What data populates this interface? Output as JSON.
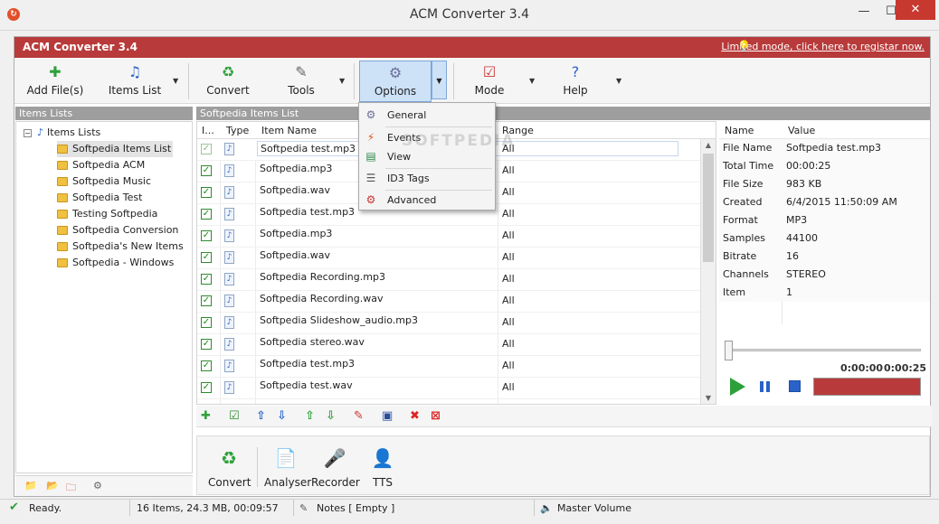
{
  "window": {
    "title": "ACM Converter 3.4",
    "min": "—",
    "max": "☐",
    "close": "✕"
  },
  "banner": {
    "app_name": "ACM Converter 3.4",
    "link": "Limited mode, click here to registar now."
  },
  "toolbar": {
    "add_files": "Add File(s)",
    "items_list": "Items List",
    "convert": "Convert",
    "tools": "Tools",
    "options": "Options",
    "mode": "Mode",
    "help": "Help"
  },
  "left_panel": {
    "header": "Items Lists",
    "root": "Items Lists",
    "items": [
      "Softpedia Items List",
      "Softpedia ACM",
      "Softpedia Music",
      "Softpedia Test",
      "Testing Softpedia",
      "Softpedia Conversion",
      "Softpedia's New Items",
      "Softpedia - Windows"
    ]
  },
  "center_panel": {
    "header": "Softpedia Items List",
    "columns": [
      "I...",
      "Type",
      "Item Name",
      "Range"
    ],
    "rows": [
      {
        "name": "Softpedia test.mp3",
        "range": "All",
        "checked_dim": true
      },
      {
        "name": "Softpedia.mp3",
        "range": "All"
      },
      {
        "name": "Softpedia.wav",
        "range": "All"
      },
      {
        "name": "Softpedia test.mp3",
        "range": "All"
      },
      {
        "name": "Softpedia.mp3",
        "range": "All"
      },
      {
        "name": "Softpedia.wav",
        "range": "All"
      },
      {
        "name": "Softpedia Recording.mp3",
        "range": "All"
      },
      {
        "name": "Softpedia Recording.wav",
        "range": "All"
      },
      {
        "name": "Softpedia Slideshow_audio.mp3",
        "range": "All"
      },
      {
        "name": "Softpedia stereo.wav",
        "range": "All"
      },
      {
        "name": "Softpedia test.mp3",
        "range": "All"
      },
      {
        "name": "Softpedia test.wav",
        "range": "All"
      }
    ]
  },
  "options_menu": {
    "items": [
      "General",
      "Events",
      "View",
      "ID3 Tags",
      "Advanced"
    ]
  },
  "watermark": "SOFTPEDIA",
  "properties": {
    "columns": [
      "Name",
      "Value"
    ],
    "rows": [
      {
        "name": "File Name",
        "value": "Softpedia test.mp3"
      },
      {
        "name": "Total Time",
        "value": "00:00:25"
      },
      {
        "name": "File Size",
        "value": "983 KB"
      },
      {
        "name": "Created",
        "value": "6/4/2015 11:50:09 AM"
      },
      {
        "name": "Format",
        "value": "MP3"
      },
      {
        "name": "Samples",
        "value": "44100"
      },
      {
        "name": "Bitrate",
        "value": "16"
      },
      {
        "name": "Channels",
        "value": "STEREO"
      },
      {
        "name": "Item",
        "value": "1"
      }
    ]
  },
  "player": {
    "current": "0:00:00",
    "total": "0:00:25"
  },
  "bottom_panel": {
    "convert": "Convert",
    "analyser": "Analyser",
    "recorder": "Recorder",
    "tts": "TTS"
  },
  "status": {
    "ready": "Ready.",
    "info": "16 Items, 24.3 MB, 00:09:57",
    "notes": "Notes [ Empty ]",
    "volume": "Master Volume"
  }
}
